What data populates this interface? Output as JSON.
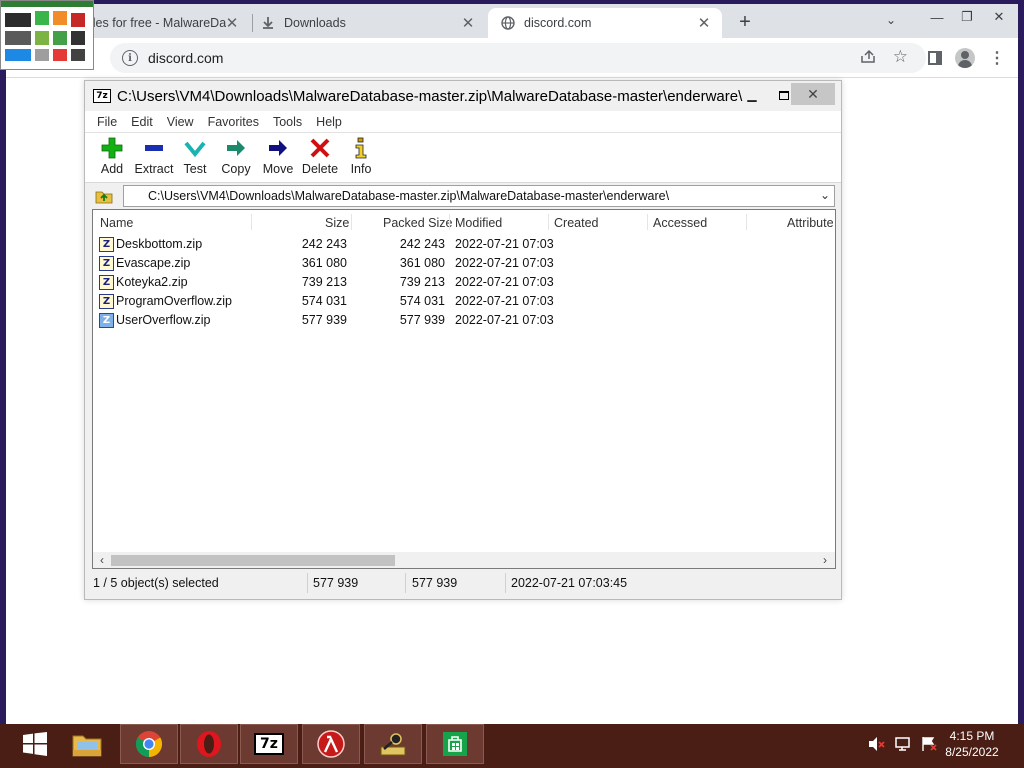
{
  "browser": {
    "tabs": [
      {
        "title": "iles for free - MalwareDa",
        "favicon": "thumbnail-favicon",
        "active": false
      },
      {
        "title": "Downloads",
        "favicon": "download-icon",
        "active": false
      },
      {
        "title": "discord.com",
        "favicon": "globe-icon",
        "active": true
      }
    ],
    "new_tab_symbol": "+",
    "address": "discord.com"
  },
  "sevenzip": {
    "path": "C:\\Users\\VM4\\Downloads\\MalwareDatabase-master.zip\\MalwareDatabase-master\\enderware\\",
    "address_value": "C:\\Users\\VM4\\Downloads\\MalwareDatabase-master.zip\\MalwareDatabase-master\\enderware\\",
    "menu": [
      "File",
      "Edit",
      "View",
      "Favorites",
      "Tools",
      "Help"
    ],
    "tools": [
      {
        "label": "Add",
        "icon": "add-icon",
        "color": "#12b012"
      },
      {
        "label": "Extract",
        "icon": "extract-icon",
        "color": "#1a2fb0"
      },
      {
        "label": "Test",
        "icon": "test-icon",
        "color": "#1ab3b3"
      },
      {
        "label": "Copy",
        "icon": "copy-icon",
        "color": "#1a8a6a"
      },
      {
        "label": "Move",
        "icon": "move-icon",
        "color": "#101080"
      },
      {
        "label": "Delete",
        "icon": "delete-icon",
        "color": "#d01010"
      },
      {
        "label": "Info",
        "icon": "info-icon",
        "color": "#c8a000"
      }
    ],
    "columns": [
      "Name",
      "Size",
      "Packed Size",
      "Modified",
      "Created",
      "Accessed",
      "Attribute"
    ],
    "files": [
      {
        "name": "Deskbottom.zip",
        "size": "242 243",
        "packed": "242 243",
        "modified": "2022-07-21 07:03",
        "selected": false
      },
      {
        "name": "Evascape.zip",
        "size": "361 080",
        "packed": "361 080",
        "modified": "2022-07-21 07:03",
        "selected": false
      },
      {
        "name": "Koteyka2.zip",
        "size": "739 213",
        "packed": "739 213",
        "modified": "2022-07-21 07:03",
        "selected": false
      },
      {
        "name": "ProgramOverflow.zip",
        "size": "574 031",
        "packed": "574 031",
        "modified": "2022-07-21 07:03",
        "selected": false
      },
      {
        "name": "UserOverflow.zip",
        "size": "577 939",
        "packed": "577 939",
        "modified": "2022-07-21 07:03",
        "selected": true
      }
    ],
    "status": {
      "selection": "1 / 5 object(s) selected",
      "size": "577 939",
      "packed": "577 939",
      "modified": "2022-07-21 07:03:45"
    }
  },
  "taskbar": {
    "pinned": [
      "windows-start-icon",
      "file-explorer-icon",
      "chrome-icon",
      "opera-icon",
      "7zip-icon",
      "halflife-icon",
      "key-tool-icon",
      "store-icon"
    ],
    "time": "4:15 PM",
    "date": "8/25/2022"
  }
}
